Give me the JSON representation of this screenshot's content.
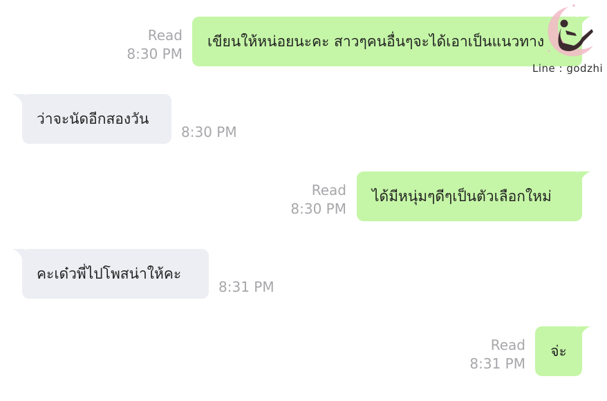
{
  "messages": [
    {
      "side": "me",
      "text": "เขียนให้หน่อยนะคะ สาวๆคนอื่นๆจะได้เอาเป็นแนวทาง",
      "status": "Read",
      "time": "8:30 PM"
    },
    {
      "side": "them",
      "text": "ว่าจะนัดอีกสองวัน",
      "time": "8:30 PM"
    },
    {
      "side": "me",
      "text": "ได้มีหนุ่มๆดีๆเป็นตัวเลือกใหม่",
      "status": "Read",
      "time": "8:30 PM"
    },
    {
      "side": "them",
      "text": "คะเด๋วพี่ไปโพสน่าให้คะ",
      "time": "8:31 PM"
    },
    {
      "side": "me",
      "text": "จ่ะ",
      "status": "Read",
      "time": "8:31 PM"
    }
  ],
  "watermark": {
    "caption": "Line : godzhi",
    "icon": "moon-silhouette-logo-icon",
    "colors": {
      "moon": "#f2b8c8",
      "figure": "#3b2a2e"
    }
  },
  "colors": {
    "my_bubble": "#c5f6a7",
    "their_bubble": "#eceef3",
    "meta_text": "#a7a7ab"
  }
}
